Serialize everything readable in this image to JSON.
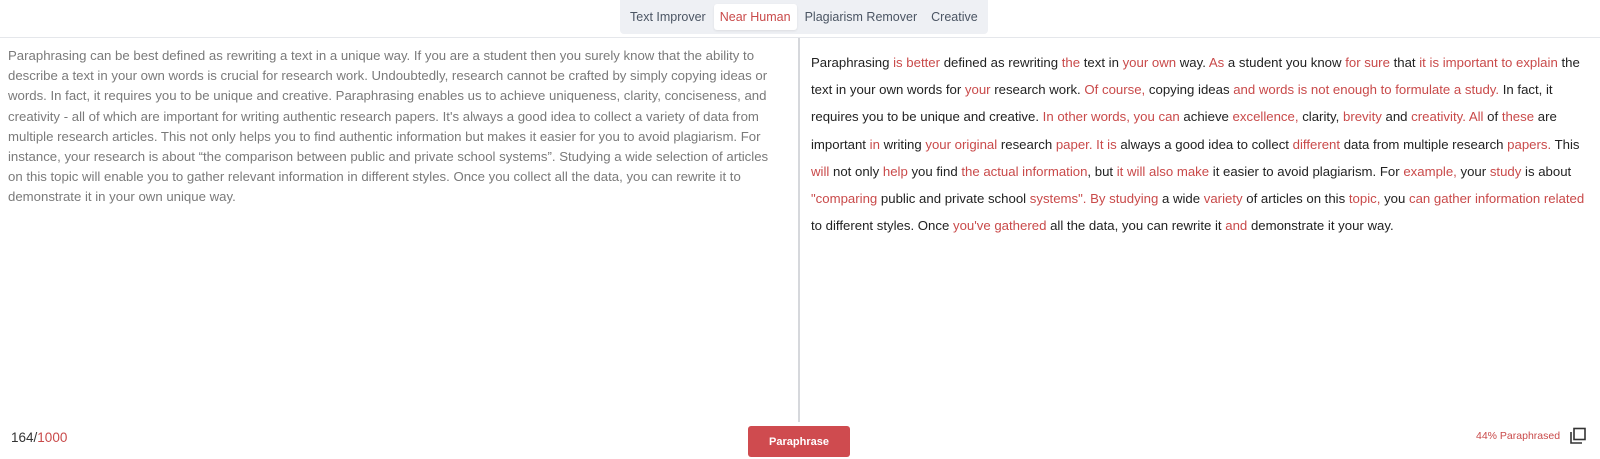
{
  "tabs": [
    "Text Improver",
    "Near Human",
    "Plagiarism Remover",
    "Creative"
  ],
  "active_tab": "Near Human",
  "accent_color": "#c94a4a",
  "input_text": "Paraphrasing can be best defined as rewriting a text in a unique way. If you are a student then you surely know that the ability to describe a text in your own words is crucial for research work. Undoubtedly, research cannot be crafted by simply copying ideas or words. In fact, it requires you to be unique and creative. Paraphrasing enables us to achieve uniqueness, clarity, conciseness, and creativity - all of which are important for writing authentic research papers. It's always a good idea to collect a variety of data from multiple research articles. This not only helps you to find authentic information but makes it easier for you to avoid plagiarism. For instance, your research is about “the comparison between public and private school systems”. Studying a wide selection of articles on this topic will enable you to gather relevant information in different styles. Once you collect all the data, you can rewrite it to demonstrate it in your own unique way.",
  "output_segments": [
    {
      "t": "Paraphrasing ",
      "h": false
    },
    {
      "t": "is better",
      "h": true
    },
    {
      "t": " defined as rewriting ",
      "h": false
    },
    {
      "t": "the",
      "h": true
    },
    {
      "t": " text in ",
      "h": false
    },
    {
      "t": "your own",
      "h": true
    },
    {
      "t": " way. ",
      "h": false
    },
    {
      "t": "As",
      "h": true
    },
    {
      "t": " a student you know ",
      "h": false
    },
    {
      "t": "for sure",
      "h": true
    },
    {
      "t": " that ",
      "h": false
    },
    {
      "t": "it is important to explain",
      "h": true
    },
    {
      "t": " the text in your own words for ",
      "h": false
    },
    {
      "t": "your",
      "h": true
    },
    {
      "t": " research work. ",
      "h": false
    },
    {
      "t": "Of course,",
      "h": true
    },
    {
      "t": " copying ideas ",
      "h": false
    },
    {
      "t": "and words is not enough to formulate a study.",
      "h": true
    },
    {
      "t": " In fact, it requires you to be unique and creative. ",
      "h": false
    },
    {
      "t": "In other words, you can",
      "h": true
    },
    {
      "t": " achieve ",
      "h": false
    },
    {
      "t": "excellence,",
      "h": true
    },
    {
      "t": " clarity, ",
      "h": false
    },
    {
      "t": "brevity",
      "h": true
    },
    {
      "t": " and ",
      "h": false
    },
    {
      "t": "creativity. All",
      "h": true
    },
    {
      "t": " of ",
      "h": false
    },
    {
      "t": "these",
      "h": true
    },
    {
      "t": " are important ",
      "h": false
    },
    {
      "t": "in",
      "h": true
    },
    {
      "t": " writing ",
      "h": false
    },
    {
      "t": "your original",
      "h": true
    },
    {
      "t": " research ",
      "h": false
    },
    {
      "t": "paper. It is",
      "h": true
    },
    {
      "t": " always a good idea to collect ",
      "h": false
    },
    {
      "t": "different",
      "h": true
    },
    {
      "t": " data from multiple research ",
      "h": false
    },
    {
      "t": "papers.",
      "h": true
    },
    {
      "t": " This ",
      "h": false
    },
    {
      "t": "will",
      "h": true
    },
    {
      "t": " not only ",
      "h": false
    },
    {
      "t": "help",
      "h": true
    },
    {
      "t": " you find ",
      "h": false
    },
    {
      "t": "the actual information",
      "h": true
    },
    {
      "t": ", but ",
      "h": false
    },
    {
      "t": "it will also make",
      "h": true
    },
    {
      "t": " it easier to avoid plagiarism. For ",
      "h": false
    },
    {
      "t": "example,",
      "h": true
    },
    {
      "t": " your ",
      "h": false
    },
    {
      "t": "study",
      "h": true
    },
    {
      "t": " is about ",
      "h": false
    },
    {
      "t": "\"comparing",
      "h": true
    },
    {
      "t": " public and private school ",
      "h": false
    },
    {
      "t": "systems\". By studying",
      "h": true
    },
    {
      "t": " a wide ",
      "h": false
    },
    {
      "t": "variety",
      "h": true
    },
    {
      "t": " of articles on this ",
      "h": false
    },
    {
      "t": "topic,",
      "h": true
    },
    {
      "t": " you ",
      "h": false
    },
    {
      "t": "can gather information related",
      "h": true
    },
    {
      "t": " to different styles. Once ",
      "h": false
    },
    {
      "t": "you've gathered",
      "h": true
    },
    {
      "t": " all the data, you can rewrite it ",
      "h": false
    },
    {
      "t": "and",
      "h": true
    },
    {
      "t": " demonstrate it your way.",
      "h": false
    }
  ],
  "counter": {
    "current": "164",
    "separator": "/",
    "max": "1000"
  },
  "paraphrase_button": "Paraphrase",
  "paraphrased_percent": "44% Paraphrased",
  "copy_icon": "copy-icon"
}
